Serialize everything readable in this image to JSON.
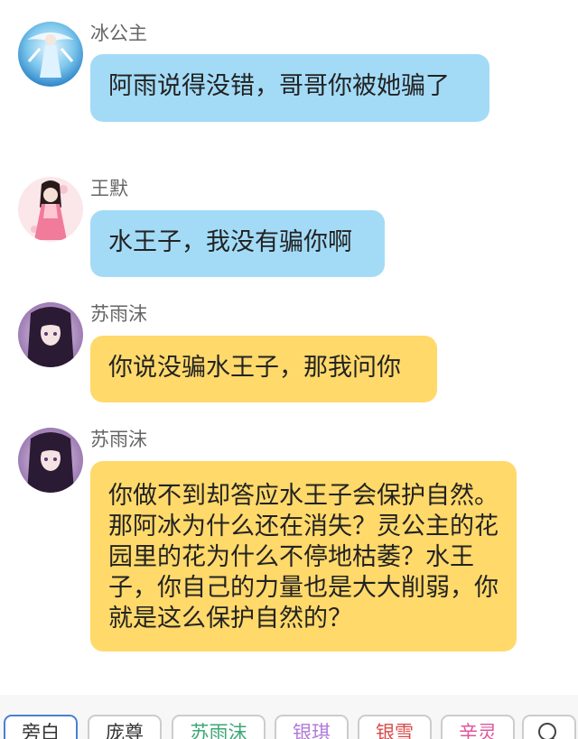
{
  "messages": [
    {
      "sender": "冰公主",
      "text": "阿雨说得没错，哥哥你被她骗了",
      "bubble_color": "#a3dbf7",
      "avatar": "ice-princess-avatar"
    },
    {
      "sender": "王默",
      "text": "水王子，我没有骗你啊",
      "bubble_color": "#a3dbf7",
      "avatar": "wang-mo-avatar"
    },
    {
      "sender": "苏雨沫",
      "text": "你说没骗水王子，那我问你",
      "bubble_color": "#ffd96a",
      "avatar": "su-yumo-avatar"
    },
    {
      "sender": "苏雨沫",
      "text": "你做不到却答应水王子会保护自然。那阿冰为什么还在消失？灵公主的花园里的花为什么不停地枯萎？水王子，你自己的力量也是大大削弱，你就是这么保护自然的？",
      "bubble_color": "#ffd96a",
      "avatar": "su-yumo-avatar"
    }
  ],
  "character_bar": {
    "chips": [
      {
        "label": "旁白",
        "color": "#333333",
        "selected": true
      },
      {
        "label": "庞尊",
        "color": "#333333",
        "selected": false
      },
      {
        "label": "苏雨沫",
        "color": "#3aa876",
        "selected": false
      },
      {
        "label": "银琪",
        "color": "#b07ad8",
        "selected": false
      },
      {
        "label": "银雪",
        "color": "#d94a4a",
        "selected": false
      },
      {
        "label": "辛灵",
        "color": "#e0559a",
        "selected": false
      }
    ],
    "search_icon": "search-icon"
  }
}
